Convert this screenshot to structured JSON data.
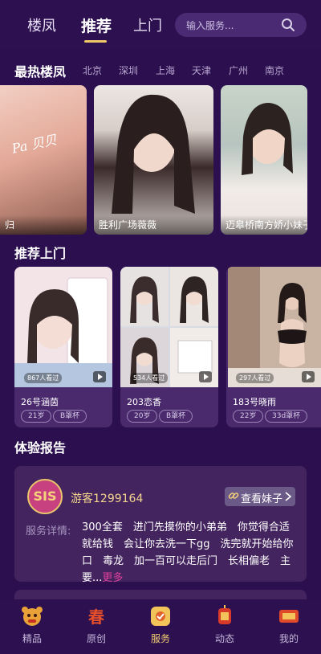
{
  "header": {
    "tabs": [
      "楼凤",
      "推荐",
      "上门"
    ],
    "active_tab": "推荐",
    "search_placeholder": "输入服务..."
  },
  "hot": {
    "title": "最热楼凤",
    "cities": [
      "北京",
      "深圳",
      "上海",
      "天津",
      "广州",
      "南京"
    ],
    "cards": [
      {
        "caption": "归",
        "overlay": "Pa 贝贝"
      },
      {
        "caption": "胜利广场薇薇"
      },
      {
        "caption": "迈皋桥南方娇小妹子"
      }
    ]
  },
  "recommend": {
    "title": "推荐上门",
    "cards": [
      {
        "name": "26号涵茵",
        "views": "867人看过",
        "age": "21岁",
        "cup": "B罩杯"
      },
      {
        "name": "203恋香",
        "views": "534人看过",
        "age": "20岁",
        "cup": "B罩杯"
      },
      {
        "name": "183号晓雨",
        "views": "297人看过",
        "age": "22岁",
        "cup": "33d罩杯"
      }
    ]
  },
  "report": {
    "title": "体验报告",
    "avatar_text": "SIS",
    "user": "游客1299164",
    "button": "查看妹子",
    "detail_label": "服务详情:",
    "detail_text": "300全套　进门先摸你的小弟弟　你觉得合适就给钱　会让你去洗一下gg　洗完就开始给你口　毒龙　加一百可以走后门　长相偏老　主要...",
    "more": "更多"
  },
  "nav": {
    "items": [
      "精品",
      "原创",
      "服务",
      "动态",
      "我的"
    ],
    "active": "服务"
  },
  "colors": {
    "background": "#2b0f4f",
    "accent": "#f1c86a",
    "card": "#43245f",
    "more_link": "#e0409b"
  }
}
